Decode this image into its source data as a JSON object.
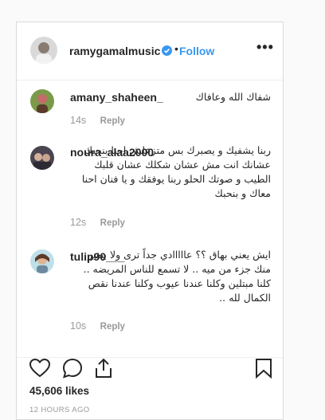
{
  "header": {
    "username": "ramygamalmusic",
    "separator": "•",
    "follow_label": "Follow",
    "more_label": "•••"
  },
  "comments": [
    {
      "username": "amany_shaheen_",
      "text": "شفاك الله وعافاك",
      "age": "14s",
      "reply_label": "Reply"
    },
    {
      "username": "noura_alaa2000",
      "text": "ربنا يشفيك و يصبرك بس متزعلش احنا بنحبك عشانك انت مش عشان شكلك عشان قلبك الطيب و صوتك الحلو ربنا يوفقك و يا فنان احنا معاك و بنحبك",
      "age": "12s",
      "reply_label": "Reply"
    },
    {
      "username": "tulip90___",
      "text": "ايش يعني بهاق ؟؟ عااااادي جداً ترى ولا بيغير منك جزء من ميه .. لا تسمع للناس المريضه .. كلنا مبتلين وكلنا عندنا عيوب وكلنا عندنا نقص الكمال لله ..",
      "age": "10s",
      "reply_label": "Reply"
    }
  ],
  "post": {
    "likes": "45,606 likes",
    "timestamp": "12 HOURS AGO"
  },
  "colors": {
    "accent": "#3897f0",
    "muted": "#999999",
    "text": "#262626",
    "border": "#dbdbdb"
  },
  "icons": [
    "verified-badge-icon",
    "more-options-icon",
    "heart-icon",
    "comment-icon",
    "share-icon",
    "bookmark-icon"
  ]
}
